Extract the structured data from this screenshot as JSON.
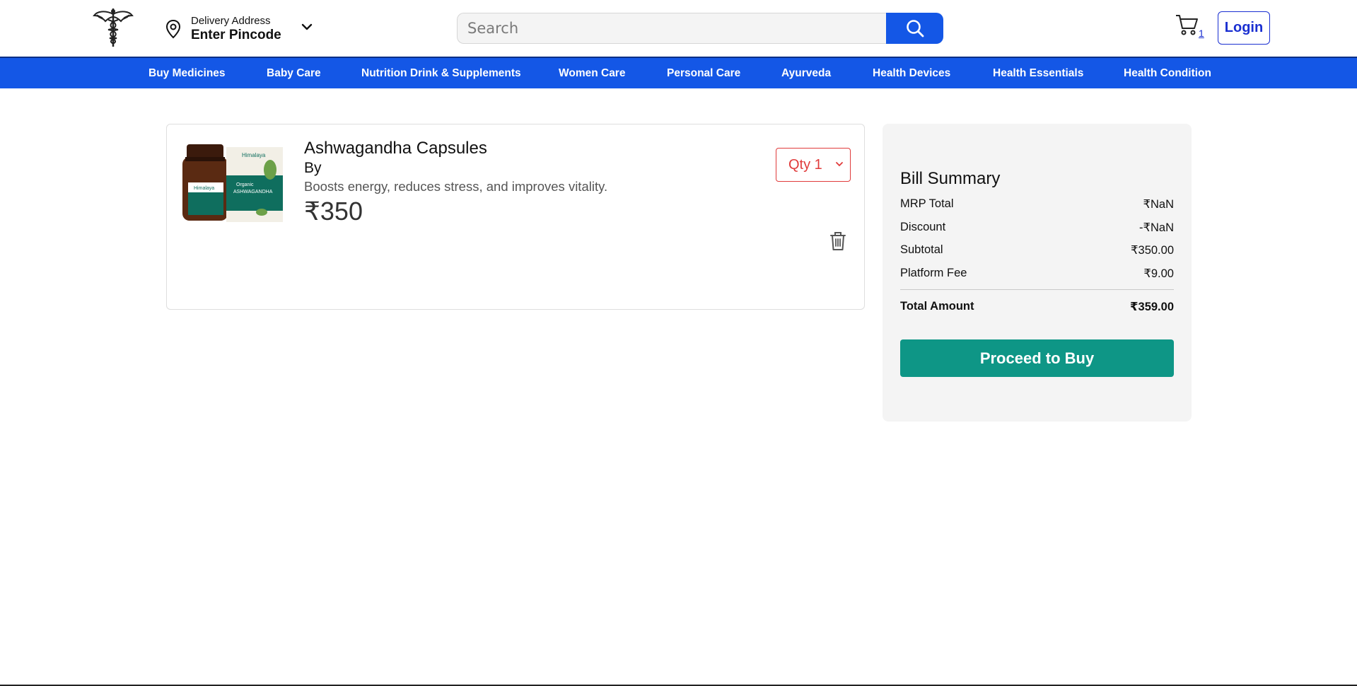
{
  "header": {
    "logo_icon": "caduceus-icon",
    "delivery": {
      "label": "Delivery Address",
      "value": "Enter Pincode",
      "pin_icon": "location-pin-icon",
      "chevron_icon": "chevron-down-icon"
    },
    "search": {
      "placeholder": "Search",
      "value": "",
      "button_icon": "search-icon"
    },
    "cart": {
      "icon": "cart-icon",
      "count": "1"
    },
    "login_label": "Login"
  },
  "nav": {
    "items": [
      {
        "label": "Buy Medicines"
      },
      {
        "label": "Baby Care"
      },
      {
        "label": "Nutrition Drink & Supplements"
      },
      {
        "label": "Women Care"
      },
      {
        "label": "Personal Care"
      },
      {
        "label": "Ayurveda"
      },
      {
        "label": "Health Devices"
      },
      {
        "label": "Health Essentials"
      },
      {
        "label": "Health Condition"
      }
    ]
  },
  "cart_items": [
    {
      "name": "Ashwagandha Capsules",
      "by": "By",
      "description": "Boosts energy, reduces stress, and improves vitality.",
      "price": "₹350",
      "qty_label": "Qty 1",
      "delete_icon": "trash-icon",
      "image_icon": "product-image"
    }
  ],
  "bill_summary": {
    "title": "Bill Summary",
    "rows": [
      {
        "label": "MRP Total",
        "value": "₹NaN"
      },
      {
        "label": "Discount",
        "value": "-₹NaN"
      },
      {
        "label": "Subtotal",
        "value": "₹350.00"
      },
      {
        "label": "Platform Fee",
        "value": "₹9.00"
      }
    ],
    "total": {
      "label": "Total Amount",
      "value": "₹359.00"
    },
    "button_label": "Proceed to Buy"
  },
  "colors": {
    "brand_blue": "#1457e6",
    "accent_teal": "#0e9686",
    "qty_red": "#e03b3b",
    "link_blue": "#1a2fd1"
  }
}
